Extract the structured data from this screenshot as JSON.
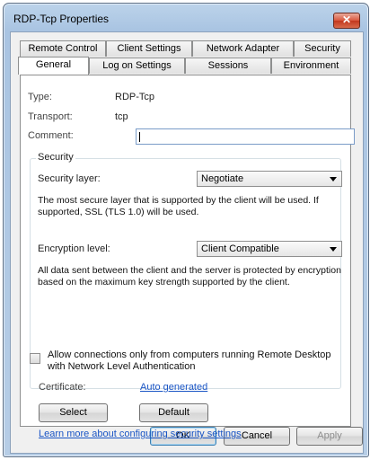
{
  "window": {
    "title": "RDP-Tcp Properties",
    "close_glyph": "✕"
  },
  "tabs": {
    "row_back": [
      "Remote Control",
      "Client Settings",
      "Network Adapter",
      "Security"
    ],
    "row_front": [
      "General",
      "Log on Settings",
      "Sessions",
      "Environment"
    ],
    "active": "General"
  },
  "general": {
    "type_label": "Type:",
    "type_value": "RDP-Tcp",
    "transport_label": "Transport:",
    "transport_value": "tcp",
    "comment_label": "Comment:",
    "comment_value": ""
  },
  "security": {
    "group_title": "Security",
    "layer_label": "Security layer:",
    "layer_value": "Negotiate",
    "layer_desc": "The most secure layer that is supported by the client will be used. If supported, SSL (TLS 1.0) will be used.",
    "encryption_label": "Encryption level:",
    "encryption_value": "Client Compatible",
    "encryption_desc": "All data sent between the client and the server is protected by encryption based on the maximum key strength supported by the client.",
    "nla_checkbox_label": "Allow connections only from computers running Remote Desktop with Network Level Authentication",
    "nla_checked": false,
    "certificate_label": "Certificate:",
    "certificate_value": "Auto generated",
    "select_label": "Select",
    "default_label": "Default",
    "learn_more_link": "Learn more about configuring security settings"
  },
  "footer": {
    "ok_label": "OK",
    "cancel_label": "Cancel",
    "apply_label": "Apply"
  },
  "icons": {
    "close": "close-icon",
    "dropdown": "chevron-down-icon",
    "cursor": "mouse-pointer-icon"
  }
}
